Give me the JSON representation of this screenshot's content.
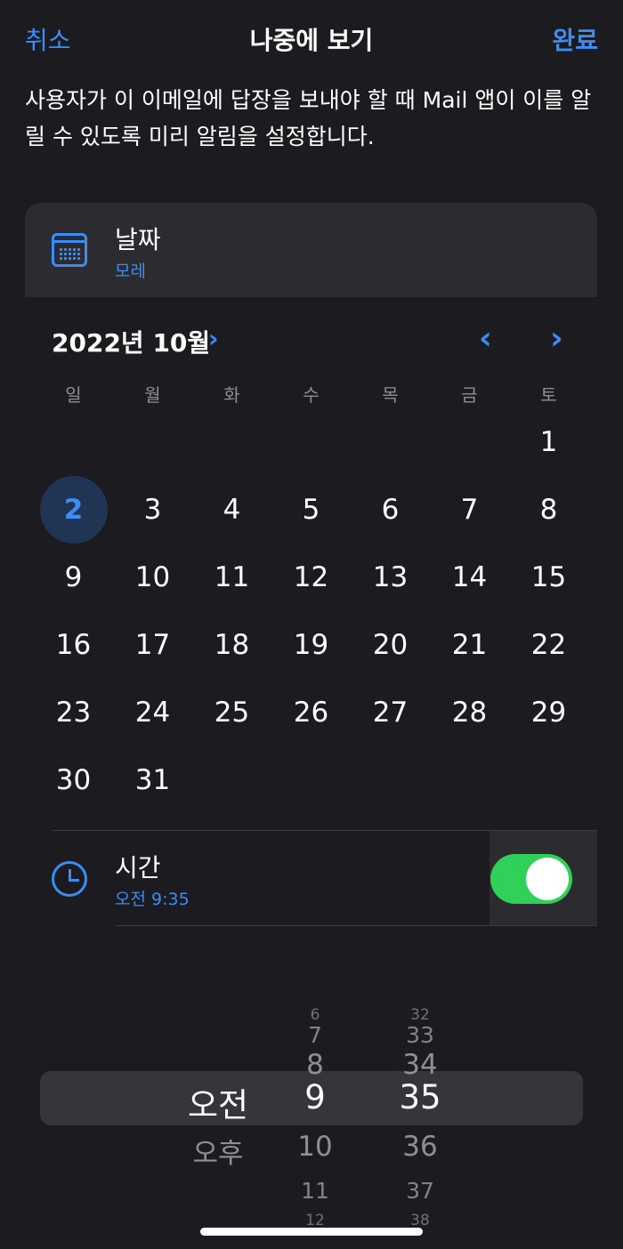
{
  "nav": {
    "cancel": "취소",
    "title": "나중에 보기",
    "done": "완료"
  },
  "description": "사용자가 이 이메일에 답장을 보내야 할 때 Mail 앱이 이를 알릴 수 있도록 미리 알림을 설정합니다.",
  "date_row": {
    "title": "날짜",
    "value": "모레",
    "icon": "calendar-icon"
  },
  "calendar": {
    "month_label": "2022년 10월",
    "month_chevron": "›",
    "prev_arrow": "‹",
    "next_arrow": "›",
    "weekdays": [
      "일",
      "월",
      "화",
      "수",
      "목",
      "금",
      "토"
    ],
    "first_weekday_index": 6,
    "days": [
      "1",
      "2",
      "3",
      "4",
      "5",
      "6",
      "7",
      "8",
      "9",
      "10",
      "11",
      "12",
      "13",
      "14",
      "15",
      "16",
      "17",
      "18",
      "19",
      "20",
      "21",
      "22",
      "23",
      "24",
      "25",
      "26",
      "27",
      "28",
      "29",
      "30",
      "31"
    ],
    "selected_day": "2"
  },
  "time_row": {
    "title": "시간",
    "value": "오전 9:35",
    "icon": "clock-icon",
    "toggle_on": true
  },
  "picker": {
    "ampm": [
      "오전",
      "오후"
    ],
    "hours": [
      "6",
      "7",
      "8",
      "9",
      "10",
      "11",
      "12"
    ],
    "minutes": [
      "32",
      "33",
      "34",
      "35",
      "36",
      "37",
      "38"
    ],
    "selected_ampm": "오전",
    "selected_hour": "9",
    "selected_minute": "35"
  },
  "colors": {
    "accent": "#3b8cf7",
    "toggle": "#30d158",
    "background": "#1c1c20",
    "card": "#2c2c30"
  }
}
